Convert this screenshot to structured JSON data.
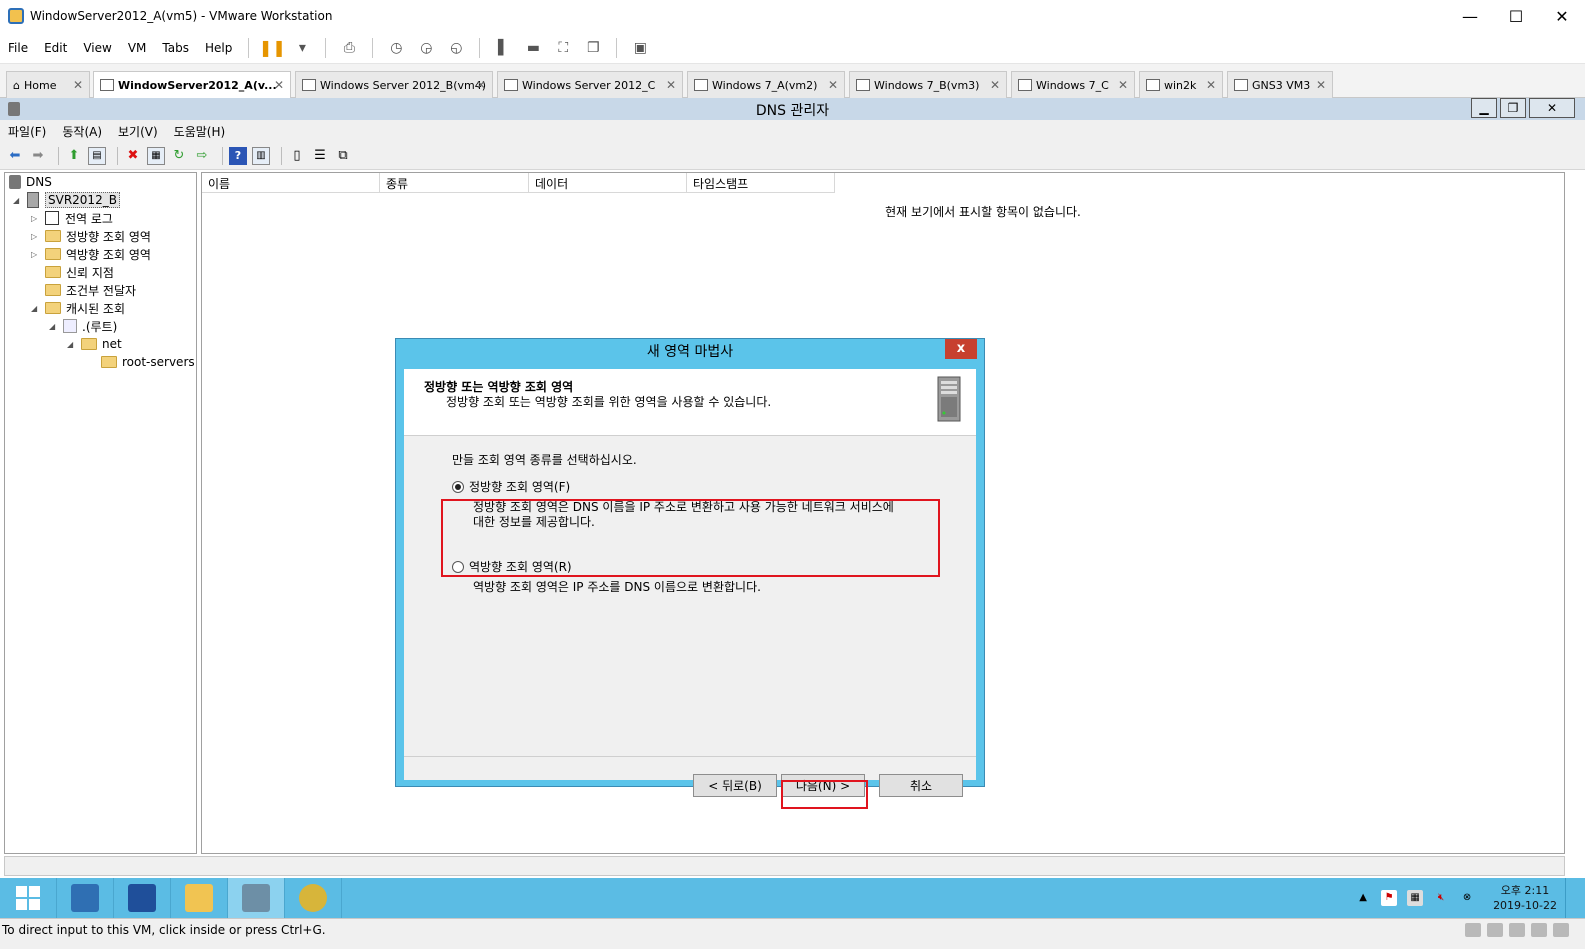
{
  "vmware": {
    "window_title": "WindowServer2012_A(vm5) - VMware Workstation",
    "menu": [
      "File",
      "Edit",
      "View",
      "VM",
      "Tabs",
      "Help"
    ],
    "tabs": [
      {
        "label": "Home"
      },
      {
        "label": "WindowServer2012_A(v..."
      },
      {
        "label": "Windows Server 2012_B(vm4)"
      },
      {
        "label": "Windows Server 2012_C"
      },
      {
        "label": "Windows 7_A(vm2)"
      },
      {
        "label": "Windows 7_B(vm3)"
      },
      {
        "label": "Windows 7_C"
      },
      {
        "label": "win2k"
      },
      {
        "label": "GNS3 VM3"
      }
    ],
    "status_text": "To direct input to this VM, click inside or press Ctrl+G."
  },
  "mmc": {
    "title": "DNS 관리자",
    "menu": [
      "파일(F)",
      "동작(A)",
      "보기(V)",
      "도움말(H)"
    ],
    "tree": {
      "root": "DNS",
      "server": "SVR2012_B",
      "items": [
        "전역 로그",
        "정방향 조회 영역",
        "역방향 조회 영역",
        "신뢰 지점",
        "조건부 전달자",
        "캐시된 조회"
      ],
      "cached": {
        "root": ".(루트)",
        "net": "net",
        "root_servers": "root-servers"
      }
    },
    "columns": [
      "이름",
      "종류",
      "데이터",
      "타임스탬프"
    ],
    "empty_message": "현재 보기에서 표시할 항목이 없습니다."
  },
  "wizard": {
    "title": "새 영역 마법사",
    "header_title": "정방향 또는 역방향 조회 영역",
    "header_subtitle": "정방향 조회 또는 역방향 조회를 위한 영역을 사용할 수 있습니다.",
    "prompt": "만들 조회 영역 종류를 선택하십시오.",
    "forward": {
      "label": "정방향 조회 영역(F)",
      "desc_line1": "정방향 조회 영역은 DNS 이름을 IP 주소로 변환하고 사용 가능한 네트워크 서비스에",
      "desc_line2": "대한 정보를 제공합니다.",
      "selected": true
    },
    "reverse": {
      "label": "역방향 조회 영역(R)",
      "desc": "역방향 조회 영역은 IP 주소를 DNS 이름으로 변환합니다.",
      "selected": false
    },
    "buttons": {
      "back": "< 뒤로(B)",
      "next": "다음(N) >",
      "cancel": "취소"
    },
    "close_glyph": "x",
    "highlight_color": "#e0141e"
  },
  "taskbar": {
    "time": "오후 2:11",
    "date": "2019-10-22"
  }
}
